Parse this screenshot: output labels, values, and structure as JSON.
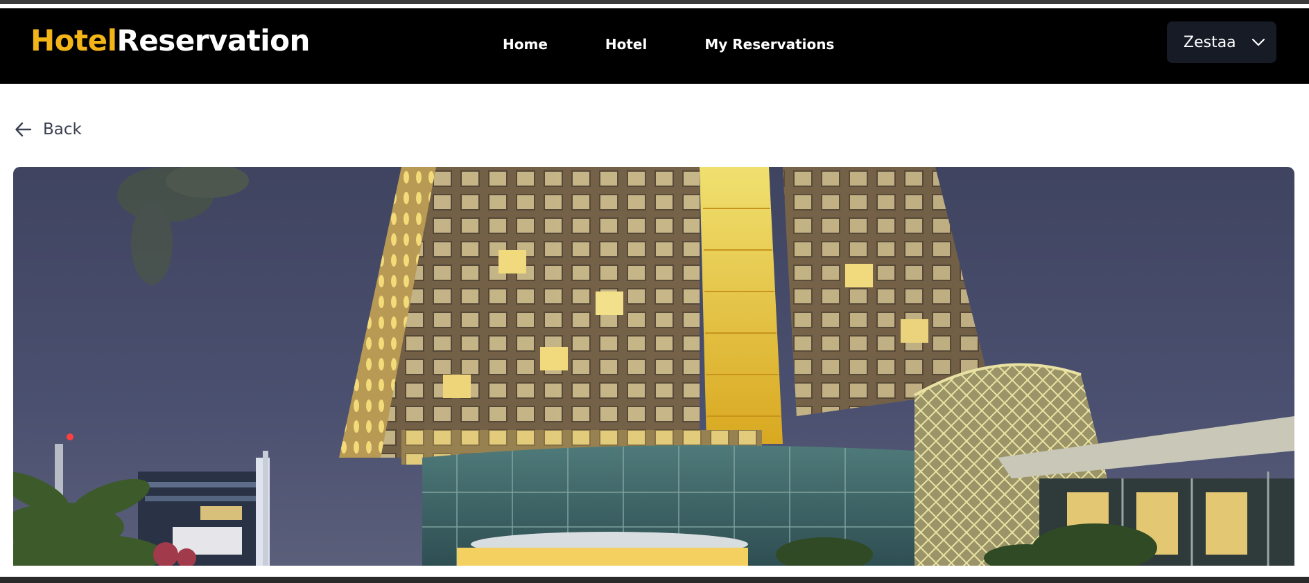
{
  "brand": {
    "part1": "Hotel",
    "part2": "Reservation",
    "accent_color": "#f2b417"
  },
  "nav": {
    "links": [
      {
        "label": "Home"
      },
      {
        "label": "Hotel"
      },
      {
        "label": "My Reservations"
      }
    ]
  },
  "user_menu": {
    "name": "Zestaa",
    "icon": "chevron-down-icon"
  },
  "back": {
    "label": "Back",
    "icon": "arrow-left-icon"
  },
  "hero": {
    "subject": "hotel-building-photo"
  },
  "colors": {
    "navbar": "#000000",
    "user_menu_bg": "#161b26",
    "back_text": "#3a4050"
  }
}
